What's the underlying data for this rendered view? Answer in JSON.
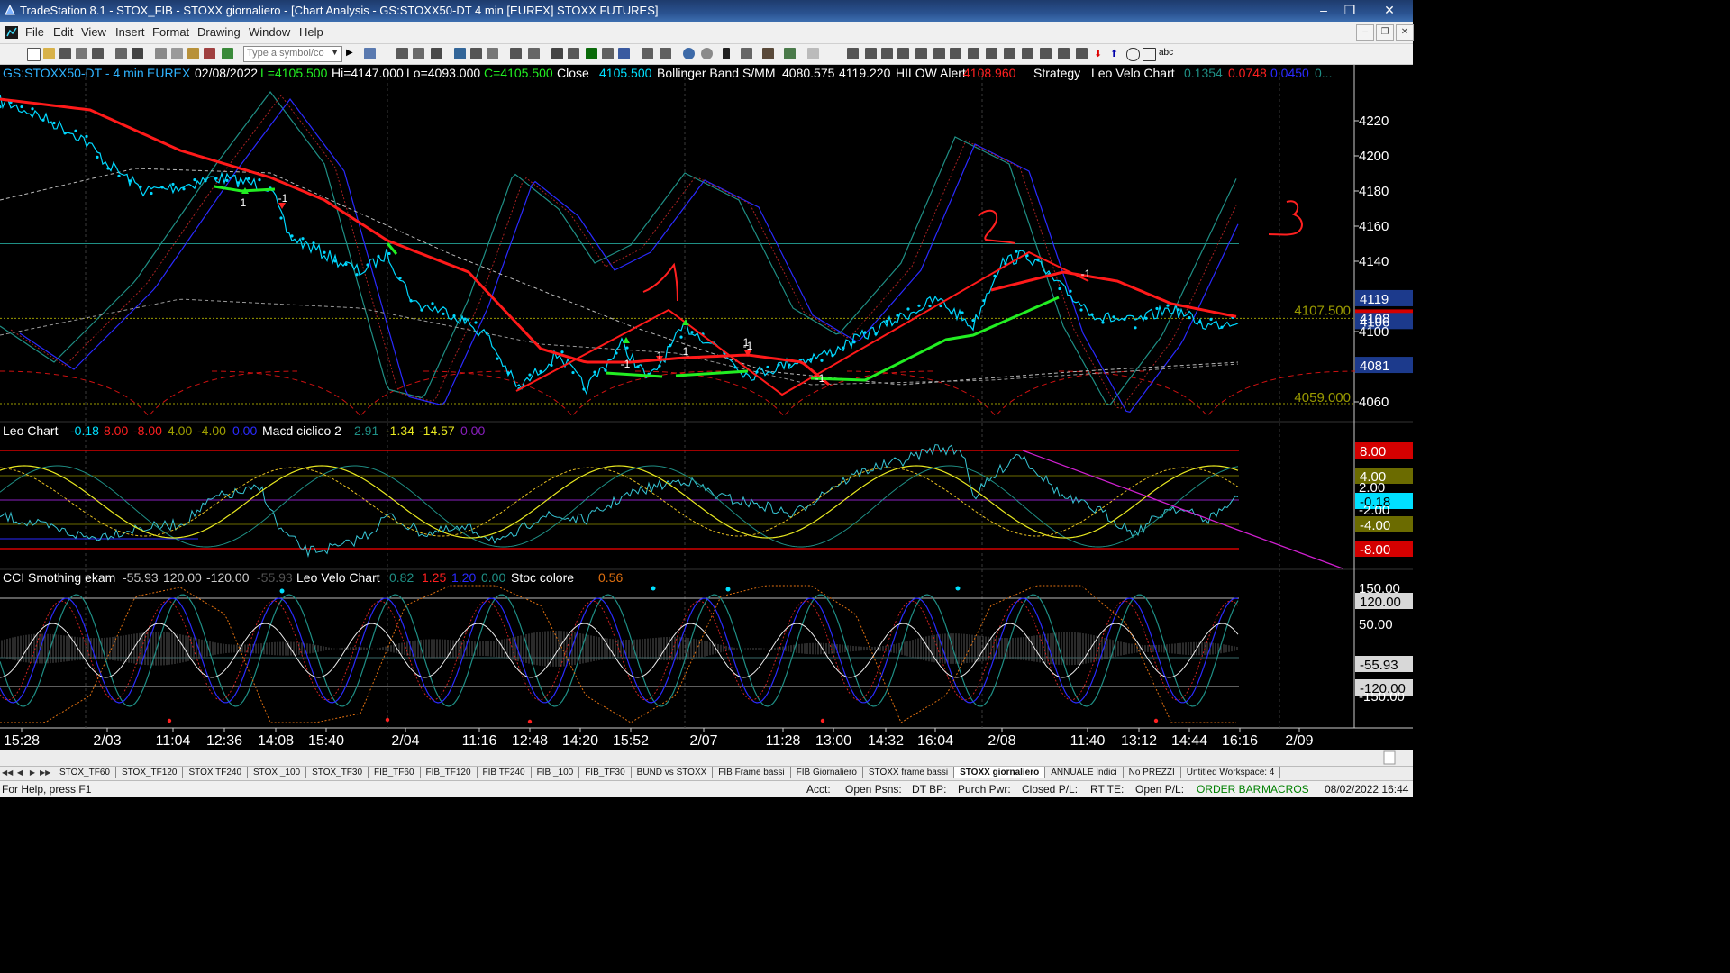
{
  "window": {
    "title": "TradeStation 8.1 - STOX_FIB - STOXX giornaliero - [Chart Analysis - GS:STOXX50-DT  4 min  [EUREX] STOXX FUTURES]"
  },
  "menu": {
    "items": [
      "File",
      "Edit",
      "View",
      "Insert",
      "Format",
      "Drawing",
      "Window",
      "Help"
    ]
  },
  "toolbar": {
    "symbol_placeholder": "Type a symbol/co",
    "text_tool_label": "abc"
  },
  "header": {
    "symbol": "GS:STOXX50-DT - 4 min",
    "exchange": "EUREX",
    "date": "02/08/2022",
    "low_label": "L=4105.500",
    "high": "Hi=4147.000",
    "lo": "Lo=4093.000",
    "close_value_label": "C=4105.500",
    "close_word": "Close",
    "close_price": "4105.500",
    "bollinger_name": "Bollinger Band S/MM",
    "bollinger_1": "4080.575",
    "bollinger_2": "4119.220",
    "hilow_name": "HILOW Alert",
    "hilow_value": "4108.960",
    "strategy": "Strategy",
    "velo_name": "Leo Velo Chart",
    "velo_1": "0.1354",
    "velo_2": "0.0748",
    "velo_3": "0.0450",
    "velo_more": "0..."
  },
  "price_axis": {
    "ticks": [
      "4220",
      "4200",
      "4180",
      "4160",
      "4140",
      "4100",
      "4060"
    ],
    "boxes": [
      {
        "text": "4119",
        "bg": "#1c3a8c",
        "fg": "#ffffff"
      },
      {
        "text": "4106",
        "bg": "#1c3a8c",
        "fg": "#ffffff"
      },
      {
        "text": "4081",
        "bg": "#1c3a8c",
        "fg": "#ffffff"
      }
    ],
    "hidden_box": "4108",
    "level_high": "4107.500",
    "level_low": "4059.000"
  },
  "panel2": {
    "name": "Leo Chart",
    "v1": "-0.18",
    "v2": "8.00",
    "v3": "-8.00",
    "v4": "4.00",
    "v5": "-4.00",
    "v6": "0.00",
    "macd_name": "Macd ciclico 2",
    "m1": "2.91",
    "m2": "-1.34",
    "m3": "-14.57",
    "m4": "0.00",
    "ticks": [
      "2.00",
      "-2.00"
    ],
    "boxes": [
      {
        "text": "8.00",
        "bg": "#d40000",
        "fg": "#ffffff"
      },
      {
        "text": "4.00",
        "bg": "#6b6b00",
        "fg": "#ffffff"
      },
      {
        "text": "-0.18",
        "bg": "#00e0ff",
        "fg": "#000000"
      },
      {
        "text": "-4.00",
        "bg": "#6b6b00",
        "fg": "#ffffff"
      },
      {
        "text": "-8.00",
        "bg": "#d40000",
        "fg": "#ffffff"
      }
    ]
  },
  "panel3": {
    "name": "CCI Smothing ekam",
    "c1": "-55.93",
    "c2": "120.00",
    "c3": "-120.00",
    "c4": "-55.93",
    "velo_name": "Leo Velo Chart",
    "v1": "0.82",
    "v2": "1.25",
    "v3": "1.20",
    "v4": "0.00",
    "stoc_name": "Stoc colore",
    "s1": "0.56",
    "ticks": [
      "150.00",
      "50.00",
      "-150.00"
    ],
    "boxes": [
      {
        "text": "120.00",
        "bg": "#d8d8d8",
        "fg": "#000000"
      },
      {
        "text": "-55.93",
        "bg": "#d8d8d8",
        "fg": "#000000"
      },
      {
        "text": "-120.00",
        "bg": "#d8d8d8",
        "fg": "#000000"
      }
    ]
  },
  "time_axis": [
    "15:28",
    "2/03",
    "11:04",
    "12:36",
    "14:08",
    "15:40",
    "2/04",
    "11:16",
    "12:48",
    "14:20",
    "15:52",
    "2/07",
    "11:28",
    "13:00",
    "14:32",
    "16:04",
    "2/08",
    "11:40",
    "13:12",
    "14:44",
    "16:16",
    "2/09"
  ],
  "annotations": {
    "trade_labels": [
      "1",
      "-1",
      "-1",
      "1",
      "1",
      "-1",
      "-1",
      "-1",
      "1"
    ],
    "handwritten_1": "1",
    "handwritten_2": "2",
    "handwritten_3": "3"
  },
  "tabs": [
    "STOX_TF60",
    "STOX_TF120",
    "STOX TF240",
    "STOX _100",
    "STOX_TF30",
    "FIB_TF60",
    "FIB_TF120",
    "FIB TF240",
    "FIB _100",
    "FIB_TF30",
    "BUND vs STOXX",
    "FIB Frame bassi",
    "FIB Giornaliero",
    "STOXX frame bassi",
    "STOXX giornaliero",
    "ANNUALE Indici",
    "No PREZZI",
    "Untitled Workspace: 4"
  ],
  "active_tab": "STOXX giornaliero",
  "status": {
    "help": "For Help, press F1",
    "acct": "Acct:",
    "open_psns": "Open Psns:",
    "dt_bp": "DT BP:",
    "purch_pwr": "Purch Pwr:",
    "closed_pl": "Closed P/L:",
    "rt_te": "RT TE:",
    "open_pl": "Open P/L:",
    "order_bar": "ORDER BAR",
    "macros": "MACROS",
    "datetime": "08/02/2022 16:44"
  },
  "colors": {
    "background": "#000000",
    "price": "#00d8ff",
    "strategy_red": "#ff1a1a",
    "green": "#22ee22",
    "bollinger_blue": "#2a2aff",
    "cycle_teal": "#1f8f85",
    "level_olive": "#9a9a00",
    "macd_yellow": "#e8e820",
    "trend_magenta": "#d020d0"
  }
}
